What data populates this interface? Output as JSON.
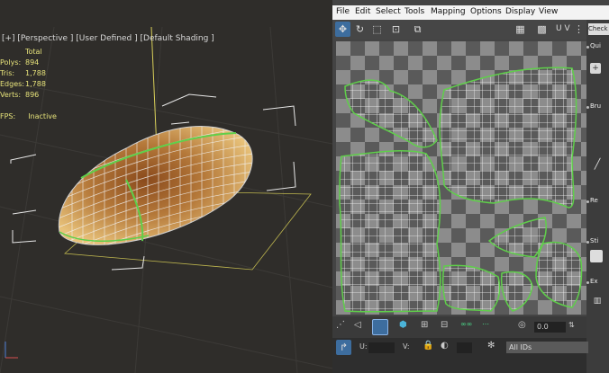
{
  "viewport": {
    "label": "[+] [Perspective ] [User Defined ] [Default Shading ]",
    "stats": {
      "header": "Total",
      "rows": [
        {
          "key": "Polys:",
          "value": "894"
        },
        {
          "key": "Tris:",
          "value": "1,788"
        },
        {
          "key": "Edges:",
          "value": "1,788"
        },
        {
          "key": "Verts:",
          "value": "896"
        }
      ]
    },
    "fps": {
      "key": "FPS:",
      "value": "Inactive"
    }
  },
  "menu": [
    "File",
    "Edit",
    "Select",
    "Tools",
    "Mapping",
    "Options",
    "Display",
    "View"
  ],
  "toolbar": {
    "uv_label": "U V"
  },
  "side_panel": {
    "checker_label": "Check",
    "sections": [
      "Qui",
      "Bru",
      "Re",
      "Sti",
      "Ex"
    ]
  },
  "bottom": {
    "spinner_value": "0.0",
    "u_label": "U:",
    "v_label": "V:",
    "ids_select": "All IDs"
  },
  "colors": {
    "wire_green": "#5fcf4a",
    "selection_blue": "#3d6d9e",
    "stats_yellow": "#e6e27a"
  }
}
